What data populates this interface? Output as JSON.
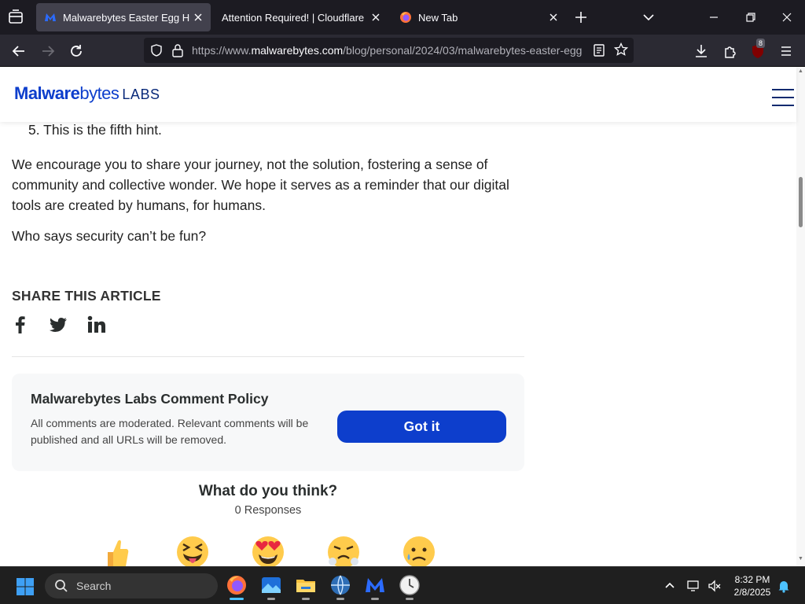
{
  "browser": {
    "tabs": [
      {
        "title": "Malwarebytes Easter Egg Hunt",
        "active": true,
        "favicon": "malwarebytes-logo-icon"
      },
      {
        "title": "Attention Required! | Cloudflare",
        "active": false,
        "favicon": "none"
      },
      {
        "title": "New Tab",
        "active": false,
        "favicon": "firefox-icon"
      }
    ],
    "url_prefix": "https://www.",
    "url_host": "malwarebytes.com",
    "url_path": "/blog/personal/2024/03/malwarebytes-easter-egg",
    "extension_badge": "8"
  },
  "site": {
    "logo_main": "Malware",
    "logo_main2": "bytes",
    "logo_labs": "LABS"
  },
  "article": {
    "hint_number": "5.",
    "hint_text": "This is the fifth hint.",
    "paragraph_1": "We encourage you to share your journey, not the solution, fostering a sense of community and collective wonder. We hope it serves as a reminder that our digital tools are created by humans, for humans.",
    "paragraph_2": "Who says security can’t be fun?",
    "share_title": "SHARE THIS ARTICLE",
    "share_icons": [
      "facebook-icon",
      "twitter-icon",
      "linkedin-icon"
    ]
  },
  "comment_policy": {
    "title": "Malwarebytes Labs Comment Policy",
    "text": "All comments are moderated. Relevant comments will be published and all URLs will be removed.",
    "button": "Got it"
  },
  "reactions": {
    "title": "What do you think?",
    "count": "0 Responses",
    "emojis": [
      "thumbs-up",
      "tongue-out",
      "heart-eyes",
      "angry",
      "sad"
    ]
  },
  "taskbar": {
    "search_placeholder": "Search",
    "time": "8:32 PM",
    "date": "2/8/2025"
  },
  "colors": {
    "brand_blue": "#0d3ecc",
    "browser_bg": "#1c1b22",
    "taskbar_bg": "#1f1f1f"
  }
}
